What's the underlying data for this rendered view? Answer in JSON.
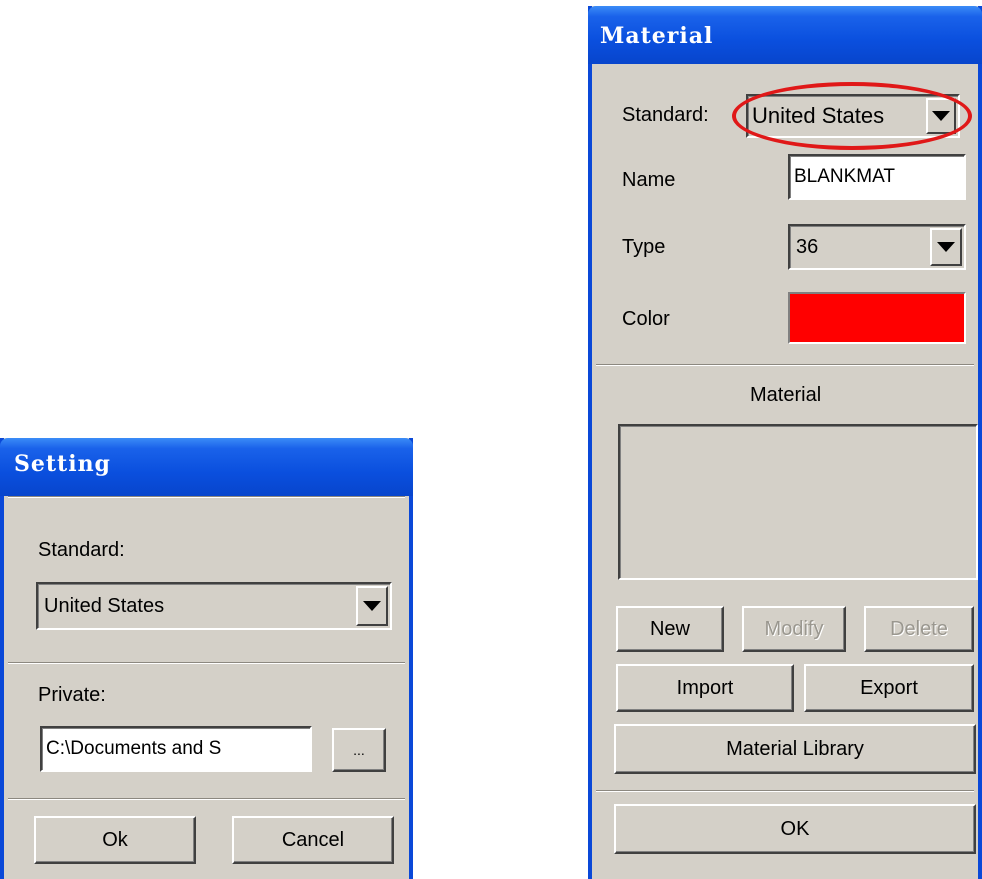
{
  "setting_dialog": {
    "title": "Setting",
    "standard_label": "Standard:",
    "standard_value": "United States",
    "private_label": "Private:",
    "private_path_value": "C:\\Documents and S",
    "browse_label": "...",
    "ok_label": "Ok",
    "cancel_label": "Cancel"
  },
  "material_dialog": {
    "title": "Material",
    "standard_label": "Standard:",
    "standard_value": "United States",
    "name_label": "Name",
    "name_value": "BLANKMAT",
    "type_label": "Type",
    "type_value": "36",
    "color_label": "Color",
    "color_value": "#ff0000",
    "material_list_label": "Material",
    "material_list_items": [],
    "new_label": "New",
    "modify_label": "Modify",
    "delete_label": "Delete",
    "import_label": "Import",
    "export_label": "Export",
    "library_label": "Material Library",
    "ok_label": "OK"
  },
  "icons": {
    "dropdown": "chevron-down-icon"
  }
}
